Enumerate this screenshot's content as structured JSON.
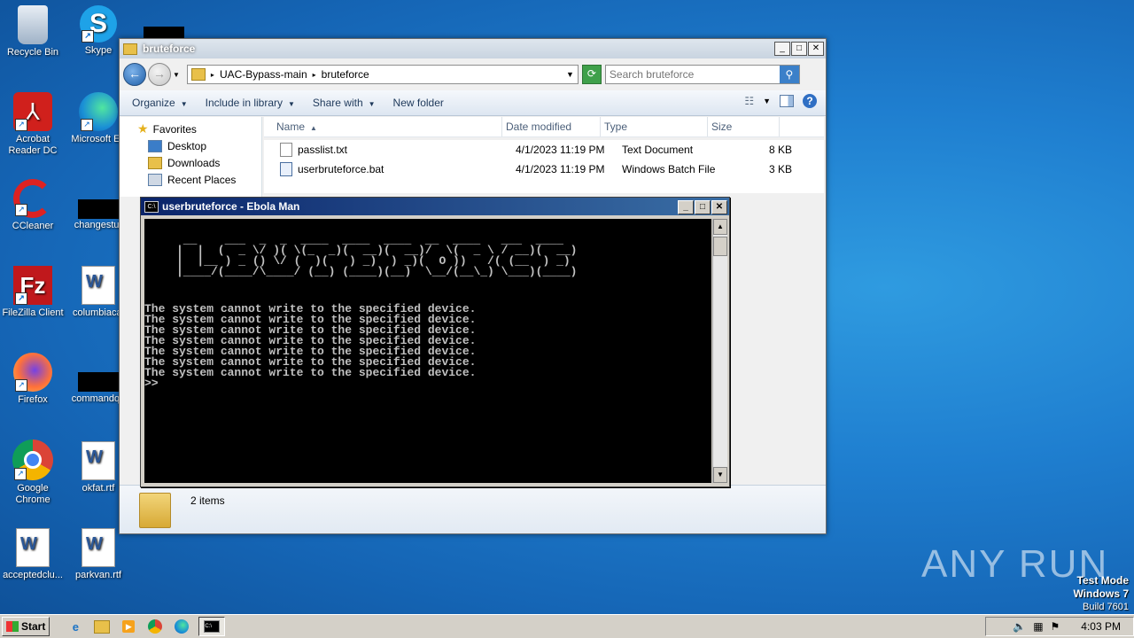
{
  "desktop": {
    "icons": [
      {
        "label": "Recycle Bin",
        "icon": "recycle-bin-icon"
      },
      {
        "label": "Skype",
        "icon": "skype-icon"
      },
      {
        "label": "Acrobat Reader DC",
        "icon": "acrobat-icon"
      },
      {
        "label": "Microsoft Ed",
        "icon": "edge-icon"
      },
      {
        "label": "CCleaner",
        "icon": "ccleaner-icon"
      },
      {
        "label": "changestur",
        "icon": "file-icon"
      },
      {
        "label": "FileZilla Client",
        "icon": "filezilla-icon"
      },
      {
        "label": "columbiacal",
        "icon": "word-doc-icon"
      },
      {
        "label": "Firefox",
        "icon": "firefox-icon"
      },
      {
        "label": "commandqu",
        "icon": "file-icon"
      },
      {
        "label": "Google Chrome",
        "icon": "chrome-icon"
      },
      {
        "label": "okfat.rtf",
        "icon": "word-doc-icon"
      },
      {
        "label": "acceptedclu...",
        "icon": "word-doc-icon"
      },
      {
        "label": "parkvan.rtf",
        "icon": "word-doc-icon"
      }
    ]
  },
  "explorer": {
    "title": "bruteforce",
    "breadcrumb": [
      "UAC-Bypass-main",
      "bruteforce"
    ],
    "search_placeholder": "Search bruteforce",
    "toolbar": {
      "organize": "Organize",
      "include": "Include in library",
      "share": "Share with",
      "new_folder": "New folder"
    },
    "nav": {
      "favorites": "Favorites",
      "desktop": "Desktop",
      "downloads": "Downloads",
      "recent": "Recent Places"
    },
    "columns": {
      "name": "Name",
      "date": "Date modified",
      "type": "Type",
      "size": "Size"
    },
    "files": [
      {
        "name": "passlist.txt",
        "date": "4/1/2023 11:19 PM",
        "type": "Text Document",
        "size": "8 KB"
      },
      {
        "name": "userbruteforce.bat",
        "date": "4/1/2023 11:19 PM",
        "type": "Windows Batch File",
        "size": "3 KB"
      }
    ],
    "item_count": "2 items"
  },
  "console": {
    "title": "userbruteforce - Ebola Man",
    "ascii_art": " __    ___  _  _  ____  ____  ____  __  ____   ___  ____  \n|  |  (  _ \\/ )( \\(_  _)(  __)(  __)/  \\(  _ \\ / __)(  __) \n|  |__ ) _ () \\/ (  )(   ) _)  ) _)(  O ))   /( (__  ) _)  \n|____/(____/\\____/ (__) (____)(__)  \\__/(__\\_) \\___)(____) ",
    "messages": [
      "The system cannot write to the specified device.",
      "The system cannot write to the specified device.",
      "The system cannot write to the specified device.",
      "The system cannot write to the specified device.",
      "The system cannot write to the specified device.",
      "The system cannot write to the specified device.",
      "The system cannot write to the specified device."
    ],
    "prompt": ">>"
  },
  "watermark": "ANY RUN",
  "test_mode": {
    "line1": "Test Mode",
    "line2": "Windows 7",
    "line3": "Build 7601"
  },
  "taskbar": {
    "start": "Start",
    "clock": "4:03 PM"
  }
}
